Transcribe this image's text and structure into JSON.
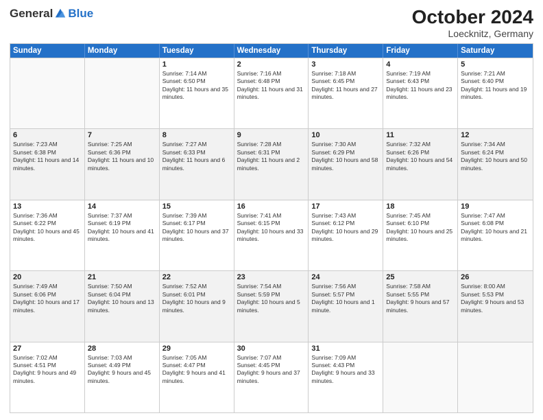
{
  "header": {
    "logo_general": "General",
    "logo_blue": "Blue",
    "month_title": "October 2024",
    "location": "Loecknitz, Germany"
  },
  "days_of_week": [
    "Sunday",
    "Monday",
    "Tuesday",
    "Wednesday",
    "Thursday",
    "Friday",
    "Saturday"
  ],
  "weeks": [
    [
      {
        "day": "",
        "info": "",
        "empty": true
      },
      {
        "day": "",
        "info": "",
        "empty": true
      },
      {
        "day": "1",
        "info": "Sunrise: 7:14 AM\nSunset: 6:50 PM\nDaylight: 11 hours and 35 minutes."
      },
      {
        "day": "2",
        "info": "Sunrise: 7:16 AM\nSunset: 6:48 PM\nDaylight: 11 hours and 31 minutes."
      },
      {
        "day": "3",
        "info": "Sunrise: 7:18 AM\nSunset: 6:45 PM\nDaylight: 11 hours and 27 minutes."
      },
      {
        "day": "4",
        "info": "Sunrise: 7:19 AM\nSunset: 6:43 PM\nDaylight: 11 hours and 23 minutes."
      },
      {
        "day": "5",
        "info": "Sunrise: 7:21 AM\nSunset: 6:40 PM\nDaylight: 11 hours and 19 minutes."
      }
    ],
    [
      {
        "day": "6",
        "info": "Sunrise: 7:23 AM\nSunset: 6:38 PM\nDaylight: 11 hours and 14 minutes."
      },
      {
        "day": "7",
        "info": "Sunrise: 7:25 AM\nSunset: 6:36 PM\nDaylight: 11 hours and 10 minutes."
      },
      {
        "day": "8",
        "info": "Sunrise: 7:27 AM\nSunset: 6:33 PM\nDaylight: 11 hours and 6 minutes."
      },
      {
        "day": "9",
        "info": "Sunrise: 7:28 AM\nSunset: 6:31 PM\nDaylight: 11 hours and 2 minutes."
      },
      {
        "day": "10",
        "info": "Sunrise: 7:30 AM\nSunset: 6:29 PM\nDaylight: 10 hours and 58 minutes."
      },
      {
        "day": "11",
        "info": "Sunrise: 7:32 AM\nSunset: 6:26 PM\nDaylight: 10 hours and 54 minutes."
      },
      {
        "day": "12",
        "info": "Sunrise: 7:34 AM\nSunset: 6:24 PM\nDaylight: 10 hours and 50 minutes."
      }
    ],
    [
      {
        "day": "13",
        "info": "Sunrise: 7:36 AM\nSunset: 6:22 PM\nDaylight: 10 hours and 45 minutes."
      },
      {
        "day": "14",
        "info": "Sunrise: 7:37 AM\nSunset: 6:19 PM\nDaylight: 10 hours and 41 minutes."
      },
      {
        "day": "15",
        "info": "Sunrise: 7:39 AM\nSunset: 6:17 PM\nDaylight: 10 hours and 37 minutes."
      },
      {
        "day": "16",
        "info": "Sunrise: 7:41 AM\nSunset: 6:15 PM\nDaylight: 10 hours and 33 minutes."
      },
      {
        "day": "17",
        "info": "Sunrise: 7:43 AM\nSunset: 6:12 PM\nDaylight: 10 hours and 29 minutes."
      },
      {
        "day": "18",
        "info": "Sunrise: 7:45 AM\nSunset: 6:10 PM\nDaylight: 10 hours and 25 minutes."
      },
      {
        "day": "19",
        "info": "Sunrise: 7:47 AM\nSunset: 6:08 PM\nDaylight: 10 hours and 21 minutes."
      }
    ],
    [
      {
        "day": "20",
        "info": "Sunrise: 7:49 AM\nSunset: 6:06 PM\nDaylight: 10 hours and 17 minutes."
      },
      {
        "day": "21",
        "info": "Sunrise: 7:50 AM\nSunset: 6:04 PM\nDaylight: 10 hours and 13 minutes."
      },
      {
        "day": "22",
        "info": "Sunrise: 7:52 AM\nSunset: 6:01 PM\nDaylight: 10 hours and 9 minutes."
      },
      {
        "day": "23",
        "info": "Sunrise: 7:54 AM\nSunset: 5:59 PM\nDaylight: 10 hours and 5 minutes."
      },
      {
        "day": "24",
        "info": "Sunrise: 7:56 AM\nSunset: 5:57 PM\nDaylight: 10 hours and 1 minute."
      },
      {
        "day": "25",
        "info": "Sunrise: 7:58 AM\nSunset: 5:55 PM\nDaylight: 9 hours and 57 minutes."
      },
      {
        "day": "26",
        "info": "Sunrise: 8:00 AM\nSunset: 5:53 PM\nDaylight: 9 hours and 53 minutes."
      }
    ],
    [
      {
        "day": "27",
        "info": "Sunrise: 7:02 AM\nSunset: 4:51 PM\nDaylight: 9 hours and 49 minutes."
      },
      {
        "day": "28",
        "info": "Sunrise: 7:03 AM\nSunset: 4:49 PM\nDaylight: 9 hours and 45 minutes."
      },
      {
        "day": "29",
        "info": "Sunrise: 7:05 AM\nSunset: 4:47 PM\nDaylight: 9 hours and 41 minutes."
      },
      {
        "day": "30",
        "info": "Sunrise: 7:07 AM\nSunset: 4:45 PM\nDaylight: 9 hours and 37 minutes."
      },
      {
        "day": "31",
        "info": "Sunrise: 7:09 AM\nSunset: 4:43 PM\nDaylight: 9 hours and 33 minutes."
      },
      {
        "day": "",
        "info": "",
        "empty": true
      },
      {
        "day": "",
        "info": "",
        "empty": true
      }
    ]
  ]
}
